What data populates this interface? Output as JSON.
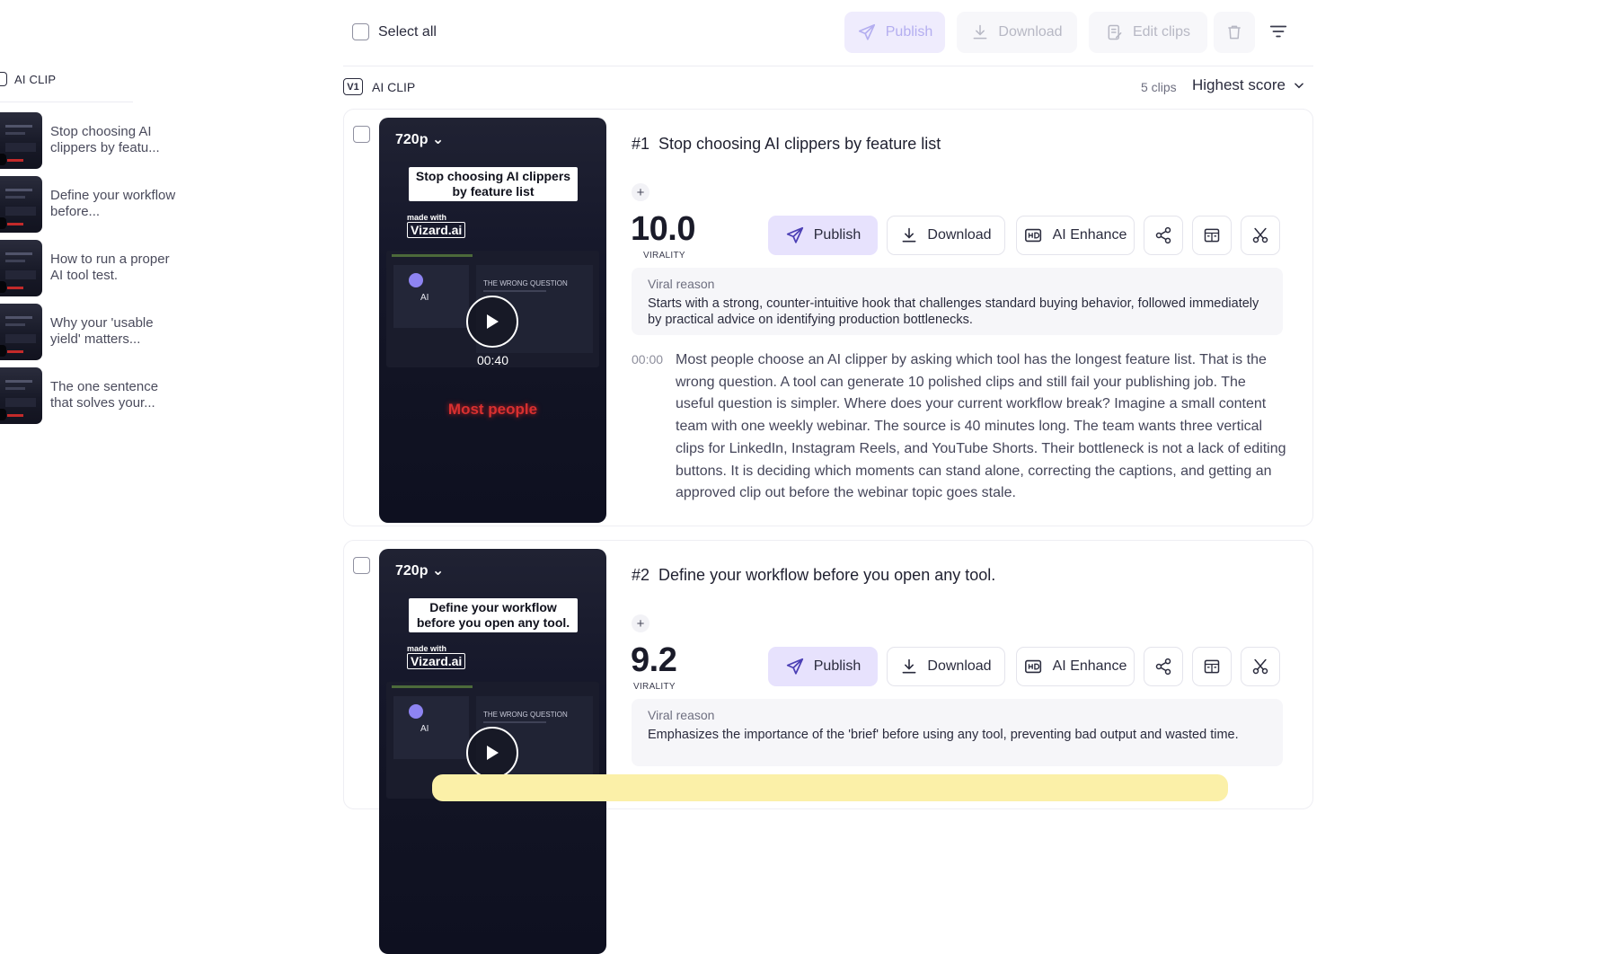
{
  "sidebar": {
    "title": "AI CLIP",
    "items": [
      {
        "label": "Stop choosing AI clippers by featu..."
      },
      {
        "label": "Define your workflow before..."
      },
      {
        "label": "How to run a proper AI tool test."
      },
      {
        "label": "Why your 'usable yield' matters..."
      },
      {
        "label": "The one sentence that solves your..."
      }
    ]
  },
  "toolbar": {
    "select_all": "Select all",
    "publish": "Publish",
    "download": "Download",
    "edit_clips": "Edit clips"
  },
  "section": {
    "version_badge": "V1",
    "title": "AI CLIP",
    "clip_count": "5 clips",
    "sort": "Highest score"
  },
  "clips": [
    {
      "rank": "#1",
      "title": "Stop choosing AI clippers by feature list",
      "resolution": "720p",
      "overlay_title": "Stop choosing AI clippers by feature list",
      "made_with": "made with",
      "brand": "Vizard.ai",
      "screen_ai": "AI",
      "screen_heading": "THE WRONG QUESTION",
      "duration": "00:40",
      "caption": "Most people",
      "score": "10.0",
      "score_label": "VIRALITY",
      "actions": {
        "publish": "Publish",
        "download": "Download",
        "enhance": "AI Enhance"
      },
      "viral_reason_label": "Viral reason",
      "viral_reason": "Starts with a strong, counter-intuitive hook that challenges standard buying behavior, followed immediately by practical advice on identifying production bottlenecks.",
      "timestamp": "00:00",
      "transcript": "Most people choose an AI clipper by asking which tool has the longest feature list. That is the wrong question. A tool can generate 10 polished clips and still fail your publishing job. The useful question is simpler. Where does your current workflow break? Imagine a small content team with one weekly webinar. The source is 40 minutes long. The team wants three vertical clips for LinkedIn, Instagram Reels, and YouTube Shorts. Their bottleneck is not a lack of editing buttons. It is deciding which moments can stand alone, correcting the captions, and getting an approved clip out before the webinar topic goes stale."
    },
    {
      "rank": "#2",
      "title": "Define your workflow before you open any tool.",
      "resolution": "720p",
      "overlay_title": "Define your workflow before you open any tool.",
      "made_with": "made with",
      "brand": "Vizard.ai",
      "screen_ai": "AI",
      "screen_heading": "THE WRONG QUESTION",
      "score": "9.2",
      "score_label": "VIRALITY",
      "actions": {
        "publish": "Publish",
        "download": "Download",
        "enhance": "AI Enhance"
      },
      "viral_reason_label": "Viral reason",
      "viral_reason": "Emphasizes the importance of the 'brief' before using any tool, preventing bad output and wasted time."
    }
  ],
  "colors": {
    "accent_light": "#e7e2fd",
    "accent_icon": "#4b3fb5",
    "toast": "#fbf0a8"
  }
}
